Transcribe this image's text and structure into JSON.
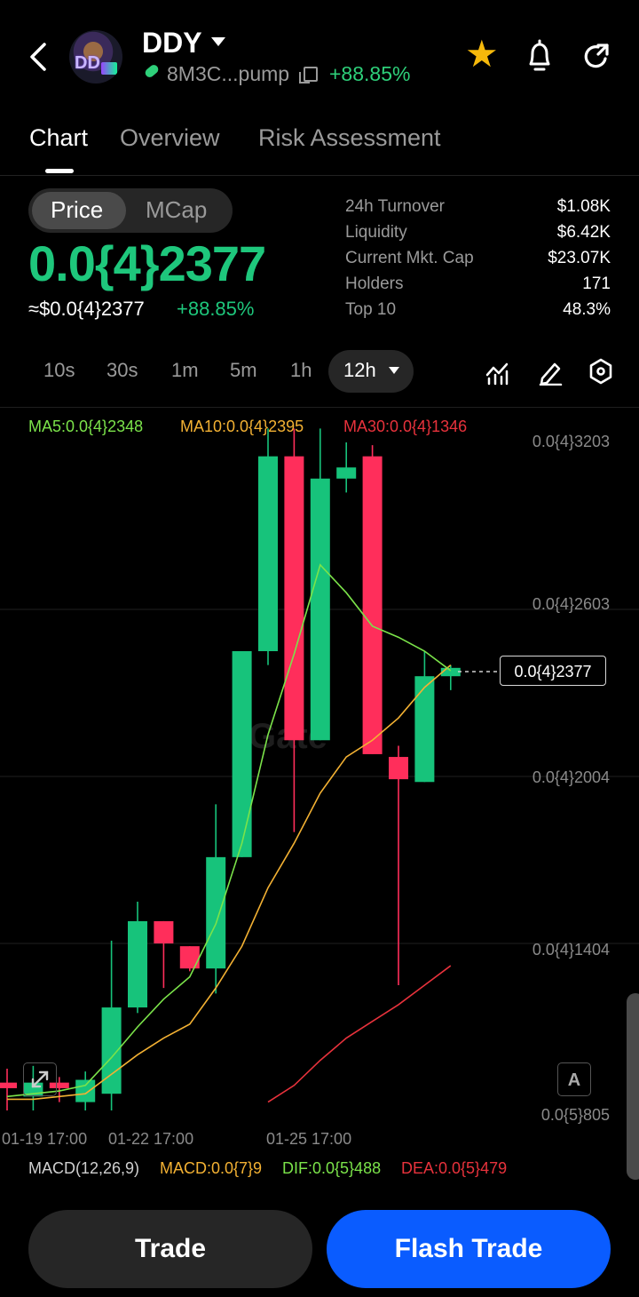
{
  "header": {
    "symbol": "DDY",
    "address": "8M3C...pump",
    "change": "+88.85%",
    "avatar_text": "DD"
  },
  "tabs": [
    "Chart",
    "Overview",
    "Risk Assessment"
  ],
  "price_panel": {
    "toggle": [
      "Price",
      "MCap"
    ],
    "price": "0.0{4}2377",
    "usd_price": "≈$0.0{4}2377",
    "usd_change": "+88.85%"
  },
  "stats": [
    {
      "label": "24h  Turnover",
      "value": "$1.08K"
    },
    {
      "label": "Liquidity",
      "value": "$6.42K"
    },
    {
      "label": "Current Mkt. Cap",
      "value": "$23.07K"
    },
    {
      "label": "Holders",
      "value": "171"
    },
    {
      "label": "Top 10",
      "value": "48.3%"
    }
  ],
  "timeframes": [
    "10s",
    "30s",
    "1m",
    "5m",
    "1h",
    "12h"
  ],
  "selected_timeframe": "12h",
  "chart": {
    "ma5": "MA5:0.0{4}2348",
    "ma10": "MA10:0.0{4}2395",
    "ma30": "MA30:0.0{4}1346",
    "y_labels": [
      "0.0{4}3203",
      "0.0{4}2603",
      "0.0{4}2004",
      "0.0{4}1404",
      "0.0{5}805"
    ],
    "x_labels": [
      "01-19 17:00",
      "01-22 17:00",
      "01-25 17:00"
    ],
    "current_price_tag": "0.0{4}2377",
    "watermark": "Gate",
    "auto_label": "A",
    "colors": {
      "up": "#17c37b",
      "down": "#ff2e5b",
      "ma5": "#7be34a",
      "ma10": "#f3b133",
      "ma30": "#e8323c"
    }
  },
  "chart_data": {
    "type": "candlestick",
    "y_ticks": [
      "0.0{4}3203",
      "0.0{4}2603",
      "0.0{4}2004",
      "0.0{4}1404",
      "0.0{5}805"
    ],
    "x_ticks": [
      "01-19 17:00",
      "01-22 17:00",
      "01-25 17:00"
    ],
    "candles": [
      {
        "open": 9e-06,
        "high": 9.5e-06,
        "low": 8e-06,
        "close": 8.8e-06
      },
      {
        "open": 8.5e-06,
        "high": 9.6e-06,
        "low": 8e-06,
        "close": 9e-06
      },
      {
        "open": 9e-06,
        "high": 9.2e-06,
        "low": 8.3e-06,
        "close": 8.8e-06
      },
      {
        "open": 8.3e-06,
        "high": 9.4e-06,
        "low": 8e-06,
        "close": 9.1e-06
      },
      {
        "open": 8.6e-06,
        "high": 1.41e-05,
        "low": 8e-06,
        "close": 1.17e-05
      },
      {
        "open": 1.17e-05,
        "high": 1.55e-05,
        "low": 1.15e-05,
        "close": 1.48e-05
      },
      {
        "open": 1.48e-05,
        "high": 1.48e-05,
        "low": 1.24e-05,
        "close": 1.4e-05
      },
      {
        "open": 1.39e-05,
        "high": 1.39e-05,
        "low": 1.3e-05,
        "close": 1.31e-05
      },
      {
        "open": 1.31e-05,
        "high": 1.9e-05,
        "low": 1.22e-05,
        "close": 1.71e-05
      },
      {
        "open": 1.71e-05,
        "high": 2.35e-05,
        "low": 1.71e-05,
        "close": 2.45e-05
      },
      {
        "open": 2.45e-05,
        "high": 3.25e-05,
        "low": 2.4e-05,
        "close": 3.15e-05
      },
      {
        "open": 3.15e-05,
        "high": 3.25e-05,
        "low": 1.8e-05,
        "close": 2.13e-05
      },
      {
        "open": 2.13e-05,
        "high": 3.25e-05,
        "low": 2.13e-05,
        "close": 3.07e-05
      },
      {
        "open": 3.07e-05,
        "high": 3.2e-05,
        "low": 3.02e-05,
        "close": 3.11e-05
      },
      {
        "open": 3.15e-05,
        "high": 3.19e-05,
        "low": 2.08e-05,
        "close": 2.08e-05
      },
      {
        "open": 2.07e-05,
        "high": 2.11e-05,
        "low": 1.25e-05,
        "close": 1.99e-05
      },
      {
        "open": 1.98e-05,
        "high": 2.45e-05,
        "low": 1.98e-05,
        "close": 2.36e-05
      },
      {
        "open": 2.36e-05,
        "high": 2.4e-05,
        "low": 2.31e-05,
        "close": 2.39e-05
      }
    ],
    "ma5_values": [
      8.5e-06,
      8.6e-06,
      8.7e-06,
      8.9e-06,
      9.9e-06,
      1.1e-05,
      1.2e-05,
      1.28e-05,
      1.47e-05,
      1.76e-05,
      2.15e-05,
      2.44e-05,
      2.76e-05,
      2.66e-05,
      2.54e-05,
      2.5e-05,
      2.45e-05,
      2.38e-05
    ],
    "ma10_values": [
      8.4e-06,
      8.4e-06,
      8.5e-06,
      8.6e-06,
      9.3e-06,
      1e-05,
      1.06e-05,
      1.11e-05,
      1.24e-05,
      1.39e-05,
      1.6e-05,
      1.76e-05,
      1.94e-05,
      2.07e-05,
      2.13e-05,
      2.21e-05,
      2.32e-05,
      2.4e-05
    ],
    "ma30_values": [
      null,
      null,
      null,
      null,
      null,
      null,
      null,
      null,
      null,
      null,
      8.3e-06,
      8.9e-06,
      9.8e-06,
      1.06e-05,
      1.12e-05,
      1.18e-05,
      1.25e-05,
      1.32e-05
    ],
    "current_price": "0.0{4}2377"
  },
  "macd": {
    "label": "MACD(12,26,9)",
    "macd": "MACD:0.0{7}9",
    "dif": "DIF:0.0{5}488",
    "dea": "DEA:0.0{5}479"
  },
  "actions": {
    "trade": "Trade",
    "flash_trade": "Flash Trade"
  }
}
